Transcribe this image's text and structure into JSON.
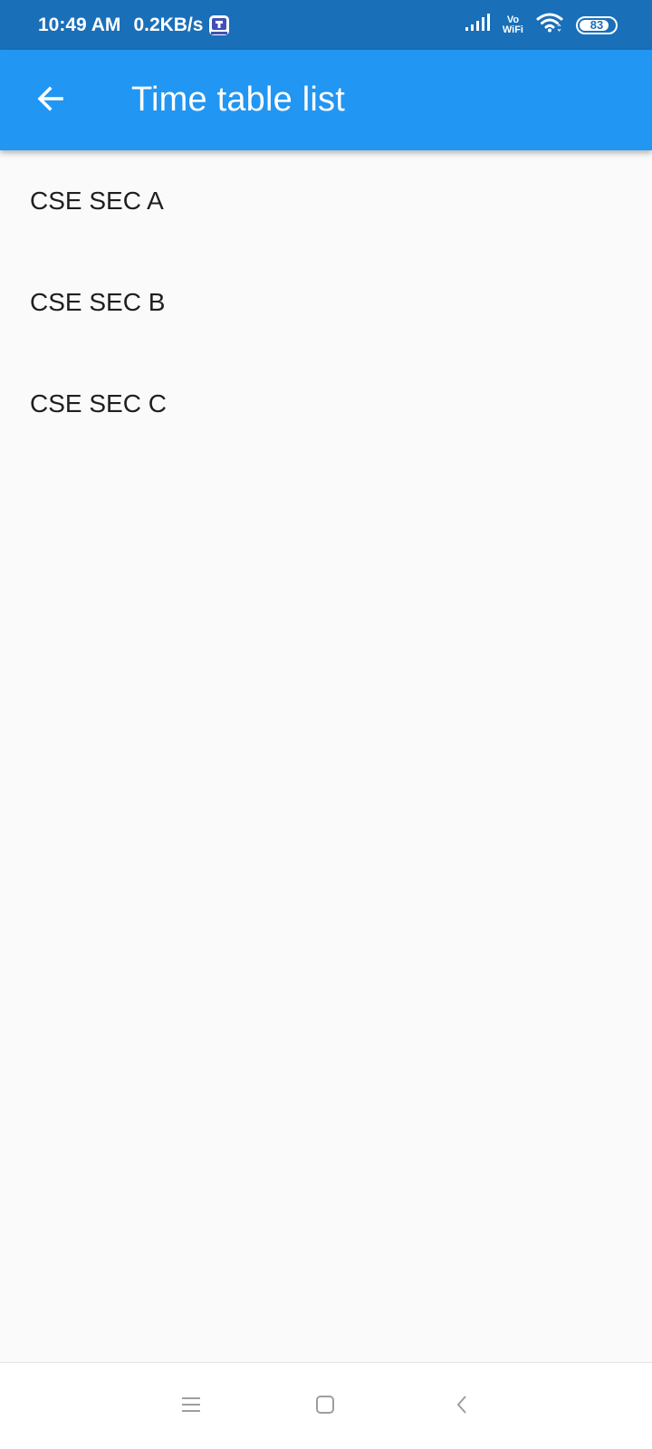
{
  "status_bar": {
    "time": "10:49 AM",
    "net_speed": "0.2KB/s",
    "vowifi_top": "Vo",
    "vowifi_bottom": "WiFi",
    "battery_level": "83",
    "battery_fraction": 0.83
  },
  "app_bar": {
    "title": "Time table list",
    "back_icon": "arrow-back-icon",
    "color": "#2196f3"
  },
  "list": {
    "items": [
      {
        "label": "CSE SEC A"
      },
      {
        "label": "CSE SEC B"
      },
      {
        "label": "CSE SEC C"
      }
    ]
  },
  "nav_bar": {
    "menu_icon": "menu-icon",
    "home_icon": "home-icon",
    "back_icon": "back-icon"
  },
  "colors": {
    "status_bar": "#1a6fb9",
    "app_bar": "#2196f3",
    "background": "#fafafa",
    "text": "#1f1f1f"
  }
}
